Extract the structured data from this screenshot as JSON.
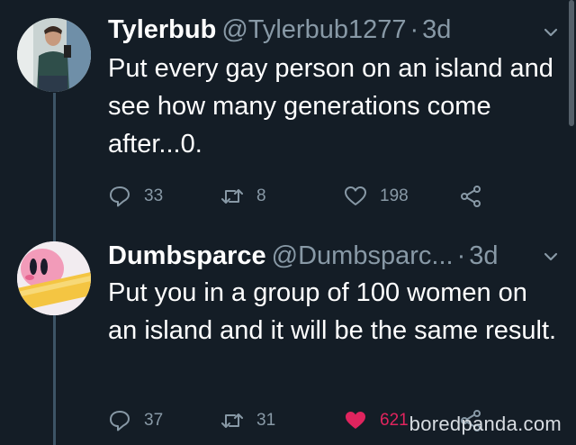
{
  "tweets": [
    {
      "name": "Tylerbub",
      "handle": "@Tylerbub1277",
      "time": "3d",
      "text": "Put every gay person on an island and see how many generations come after...0.",
      "replies": "33",
      "retweets": "8",
      "likes": "198",
      "liked": false
    },
    {
      "name": "Dumbsparce",
      "handle": "@Dumbsparc...",
      "time": "3d",
      "text": "Put you in a group of 100 women on an island and it will be the same result.",
      "replies": "37",
      "retweets": "31",
      "likes": "621",
      "liked": true
    }
  ],
  "separator": "·",
  "watermark": "boredpanda.com",
  "colors": {
    "background": "#141d26",
    "muted": "#8899a6",
    "like_active": "#e0245e",
    "thread_line": "#3d5466"
  }
}
